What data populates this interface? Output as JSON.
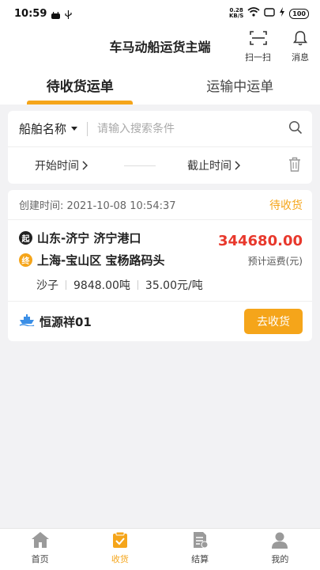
{
  "statusbar": {
    "time": "10:59",
    "net_speed_value": "0.28",
    "net_speed_unit": "KB/S",
    "battery": "100"
  },
  "header": {
    "title": "车马动船运货主端",
    "scan_label": "扫一扫",
    "message_label": "消息"
  },
  "tabs": [
    {
      "label": "待收货运单",
      "active": true
    },
    {
      "label": "运输中运单",
      "active": false
    }
  ],
  "search": {
    "ship_select_label": "船舶名称",
    "placeholder": "请输入搜索条件",
    "start_time_label": "开始时间",
    "end_time_label": "截止时间"
  },
  "order": {
    "created_label": "创建时间: 2021-10-08 10:54:37",
    "status": "待收货",
    "origin_badge": "起",
    "origin": "山东-济宁 济宁港口",
    "dest_badge": "终",
    "destination": "上海-宝山区 宝杨路码头",
    "freight_amount": "344680.00",
    "freight_label": "预计运费(元)",
    "cargo": "沙子",
    "weight": "9848.00吨",
    "unit_price": "35.00元/吨",
    "ship_name": "恒源祥01",
    "receive_button": "去收货"
  },
  "bottom_nav": [
    {
      "label": "首页",
      "icon": "home-icon",
      "active": false
    },
    {
      "label": "收货",
      "icon": "receive-icon",
      "active": true
    },
    {
      "label": "结算",
      "icon": "settlement-icon",
      "active": false
    },
    {
      "label": "我的",
      "icon": "profile-icon",
      "active": false
    }
  ],
  "colors": {
    "accent": "#f5a51a",
    "price": "#e8382c",
    "background": "#f2f2f4"
  }
}
